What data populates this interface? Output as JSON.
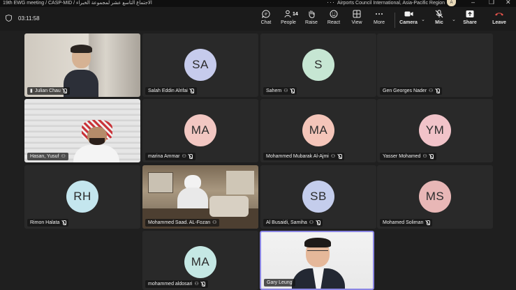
{
  "window": {
    "title": "19th EWG meeting / CASP-MID / الاجتماع التاسع عشر لمجموعة الخبراء",
    "org": "Airports Council International, Asia-Pacific Region",
    "avatar_initial": "A"
  },
  "toolbar": {
    "timer": "03:11:58",
    "chat_label": "Chat",
    "people_label": "People",
    "people_count": "14",
    "raise_label": "Raise",
    "react_label": "React",
    "view_label": "View",
    "more_label": "More",
    "camera_label": "Camera",
    "mic_label": "Mic",
    "share_label": "Share",
    "leave_label": "Leave"
  },
  "colors": {
    "leave": "#e5534b",
    "speaking_border": "#8b86e3",
    "tile_bg": "#292929"
  },
  "participants": [
    {
      "name": "Julian Chau",
      "initials": "",
      "video": true
    },
    {
      "name": "Salah Eddin Alrifai",
      "initials": "SA",
      "color": "#c6cbec"
    },
    {
      "name": "Sahem",
      "initials": "S",
      "color": "#c6e6d3"
    },
    {
      "name": "Gen Georges Nader",
      "initials": "",
      "video": false
    },
    {
      "name": "Hasan, Yusuf",
      "initials": "",
      "video": true
    },
    {
      "name": "marina Ammar",
      "initials": "MA",
      "color": "#f2c7c2"
    },
    {
      "name": "Mohammed Mubarak Al-Ajmi",
      "initials": "MA",
      "color": "#f4c5b9"
    },
    {
      "name": "Yasser Mohamed",
      "initials": "YM",
      "color": "#f1c3c9"
    },
    {
      "name": "Rimon Halata",
      "initials": "RH",
      "color": "#c4e6ee"
    },
    {
      "name": "Mohammed Saad. AL-Fozan",
      "initials": "",
      "video": true
    },
    {
      "name": "Al Busaidi, Samiha",
      "initials": "SB",
      "color": "#c4cdec"
    },
    {
      "name": "Mohamed Soliman",
      "initials": "MS",
      "color": "#e8b7b6"
    },
    {
      "name": "mohammed aldosari",
      "initials": "MA",
      "color": "#c5e8e4"
    },
    {
      "name": "Gary Leung",
      "initials": "",
      "video": true
    }
  ]
}
